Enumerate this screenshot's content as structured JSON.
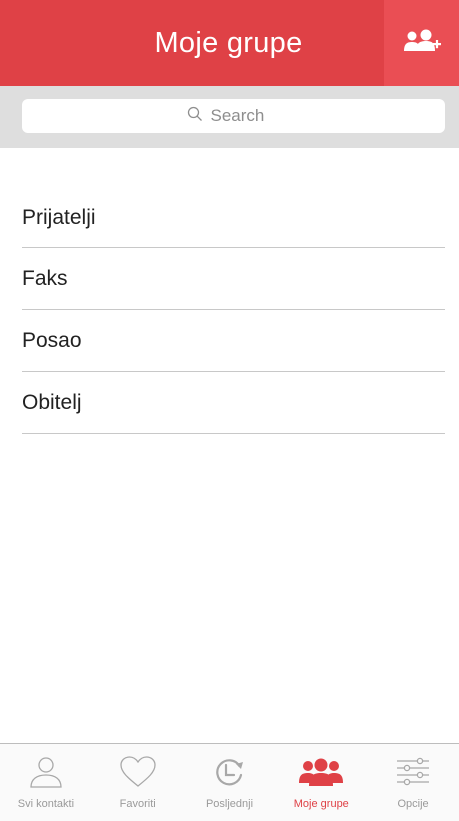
{
  "header": {
    "title": "Moje grupe",
    "add_icon": "add-group-icon"
  },
  "search": {
    "placeholder": "Search"
  },
  "groups": [
    {
      "label": "Prijatelji"
    },
    {
      "label": "Faks"
    },
    {
      "label": "Posao"
    },
    {
      "label": "Obitelj"
    }
  ],
  "tabbar": {
    "tabs": [
      {
        "label": "Svi kontakti",
        "icon": "person-icon",
        "active": false
      },
      {
        "label": "Favoriti",
        "icon": "heart-icon",
        "active": false
      },
      {
        "label": "Posljednji",
        "icon": "recent-clock-icon",
        "active": false
      },
      {
        "label": "Moje grupe",
        "icon": "group-icon",
        "active": true
      },
      {
        "label": "Opcije",
        "icon": "sliders-icon",
        "active": false
      }
    ]
  },
  "colors": {
    "accent": "#df4146",
    "accent_light": "#ea4e54",
    "inactive": "#9a9a9a"
  }
}
